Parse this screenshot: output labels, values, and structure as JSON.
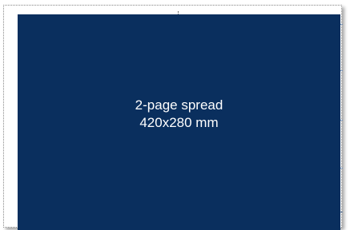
{
  "spread": {
    "line1": "2-page spread",
    "line2": "420x280 mm",
    "panel_color": "#0a2f5e",
    "text_color": "#ffffff"
  }
}
